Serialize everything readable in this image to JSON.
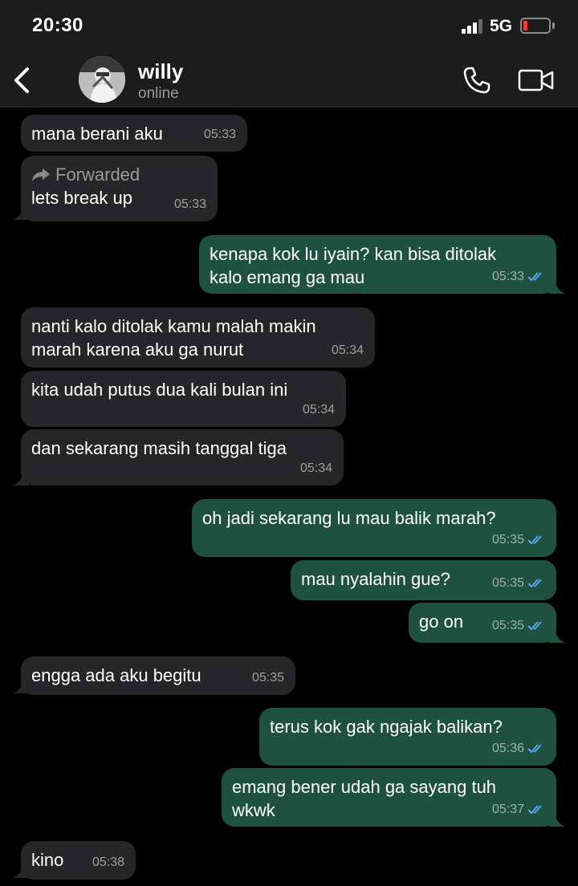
{
  "status_bar": {
    "time": "20:30",
    "network": "5G"
  },
  "header": {
    "name": "willy",
    "status": "online"
  },
  "messages": [
    {
      "dir": "in",
      "text": "mana berani aku",
      "time": "05:33"
    },
    {
      "dir": "in",
      "forwarded_label": "Forwarded",
      "text": "lets break up",
      "time": "05:33"
    },
    {
      "dir": "out",
      "line1": "kenapa kok lu iyain? kan bisa ditolak",
      "line2": "kalo emang ga mau",
      "time": "05:33"
    },
    {
      "dir": "in",
      "line1": "nanti kalo ditolak kamu malah makin",
      "line2": "marah karena aku ga nurut",
      "time": "05:34"
    },
    {
      "dir": "in",
      "text": "kita udah putus dua kali bulan ini",
      "time": "05:34"
    },
    {
      "dir": "in",
      "text": "dan sekarang masih tanggal tiga",
      "time": "05:34"
    },
    {
      "dir": "out",
      "text": "oh jadi sekarang lu mau balik marah?",
      "time": "05:35"
    },
    {
      "dir": "out",
      "text": "mau nyalahin gue?",
      "time": "05:35"
    },
    {
      "dir": "out",
      "text": "go on",
      "time": "05:35"
    },
    {
      "dir": "in",
      "text": "engga ada aku begitu",
      "time": "05:35"
    },
    {
      "dir": "out",
      "text": "terus kok gak ngajak balikan?",
      "time": "05:36"
    },
    {
      "dir": "out",
      "line1": "emang bener udah ga sayang tuh",
      "line2": "wkwk",
      "time": "05:37"
    },
    {
      "dir": "in",
      "text": "kino",
      "time": "05:38"
    }
  ],
  "colors": {
    "incoming": "#262628",
    "outgoing": "#1f5140",
    "read_ticks": "#53a6f0"
  },
  "icons": [
    "back-chevron-icon",
    "phone-icon",
    "video-camera-icon",
    "forward-arrow-icon",
    "double-check-icon"
  ]
}
